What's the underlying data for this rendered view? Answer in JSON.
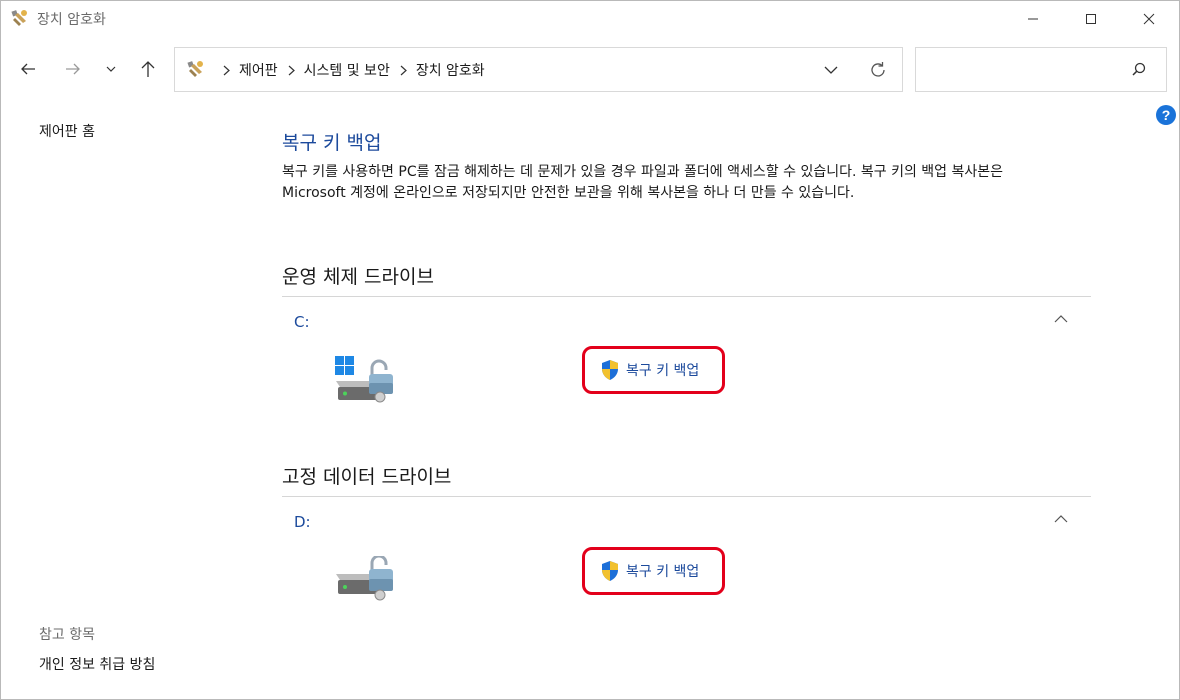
{
  "window": {
    "title": "장치 암호화"
  },
  "address": {
    "crumbs": [
      "제어판",
      "시스템 및 보안",
      "장치 암호화"
    ]
  },
  "search": {
    "placeholder": ""
  },
  "left_pane": {
    "home": "제어판 홈",
    "see_also_heading": "참고 항목",
    "privacy_link": "개인 정보 취급 방침"
  },
  "main": {
    "title": "복구 키 백업",
    "description": "복구 키를 사용하면 PC를 잠금 해제하는 데 문제가 있을 경우 파일과 폴더에 액세스할 수 있습니다. 복구 키의 백업 복사본은 Microsoft 계정에 온라인으로 저장되지만 안전한 보관을 위해 복사본을 하나 더 만들 수 있습니다.",
    "sections": [
      {
        "heading": "운영 체제 드라이브",
        "drive_label": "C:",
        "action_label": "복구 키 백업"
      },
      {
        "heading": "고정 데이터 드라이브",
        "drive_label": "D:",
        "action_label": "복구 키 백업"
      }
    ]
  },
  "colors": {
    "link_blue": "#1c4a9c",
    "highlight_red": "#e3001b",
    "help_blue": "#1a73d9"
  }
}
